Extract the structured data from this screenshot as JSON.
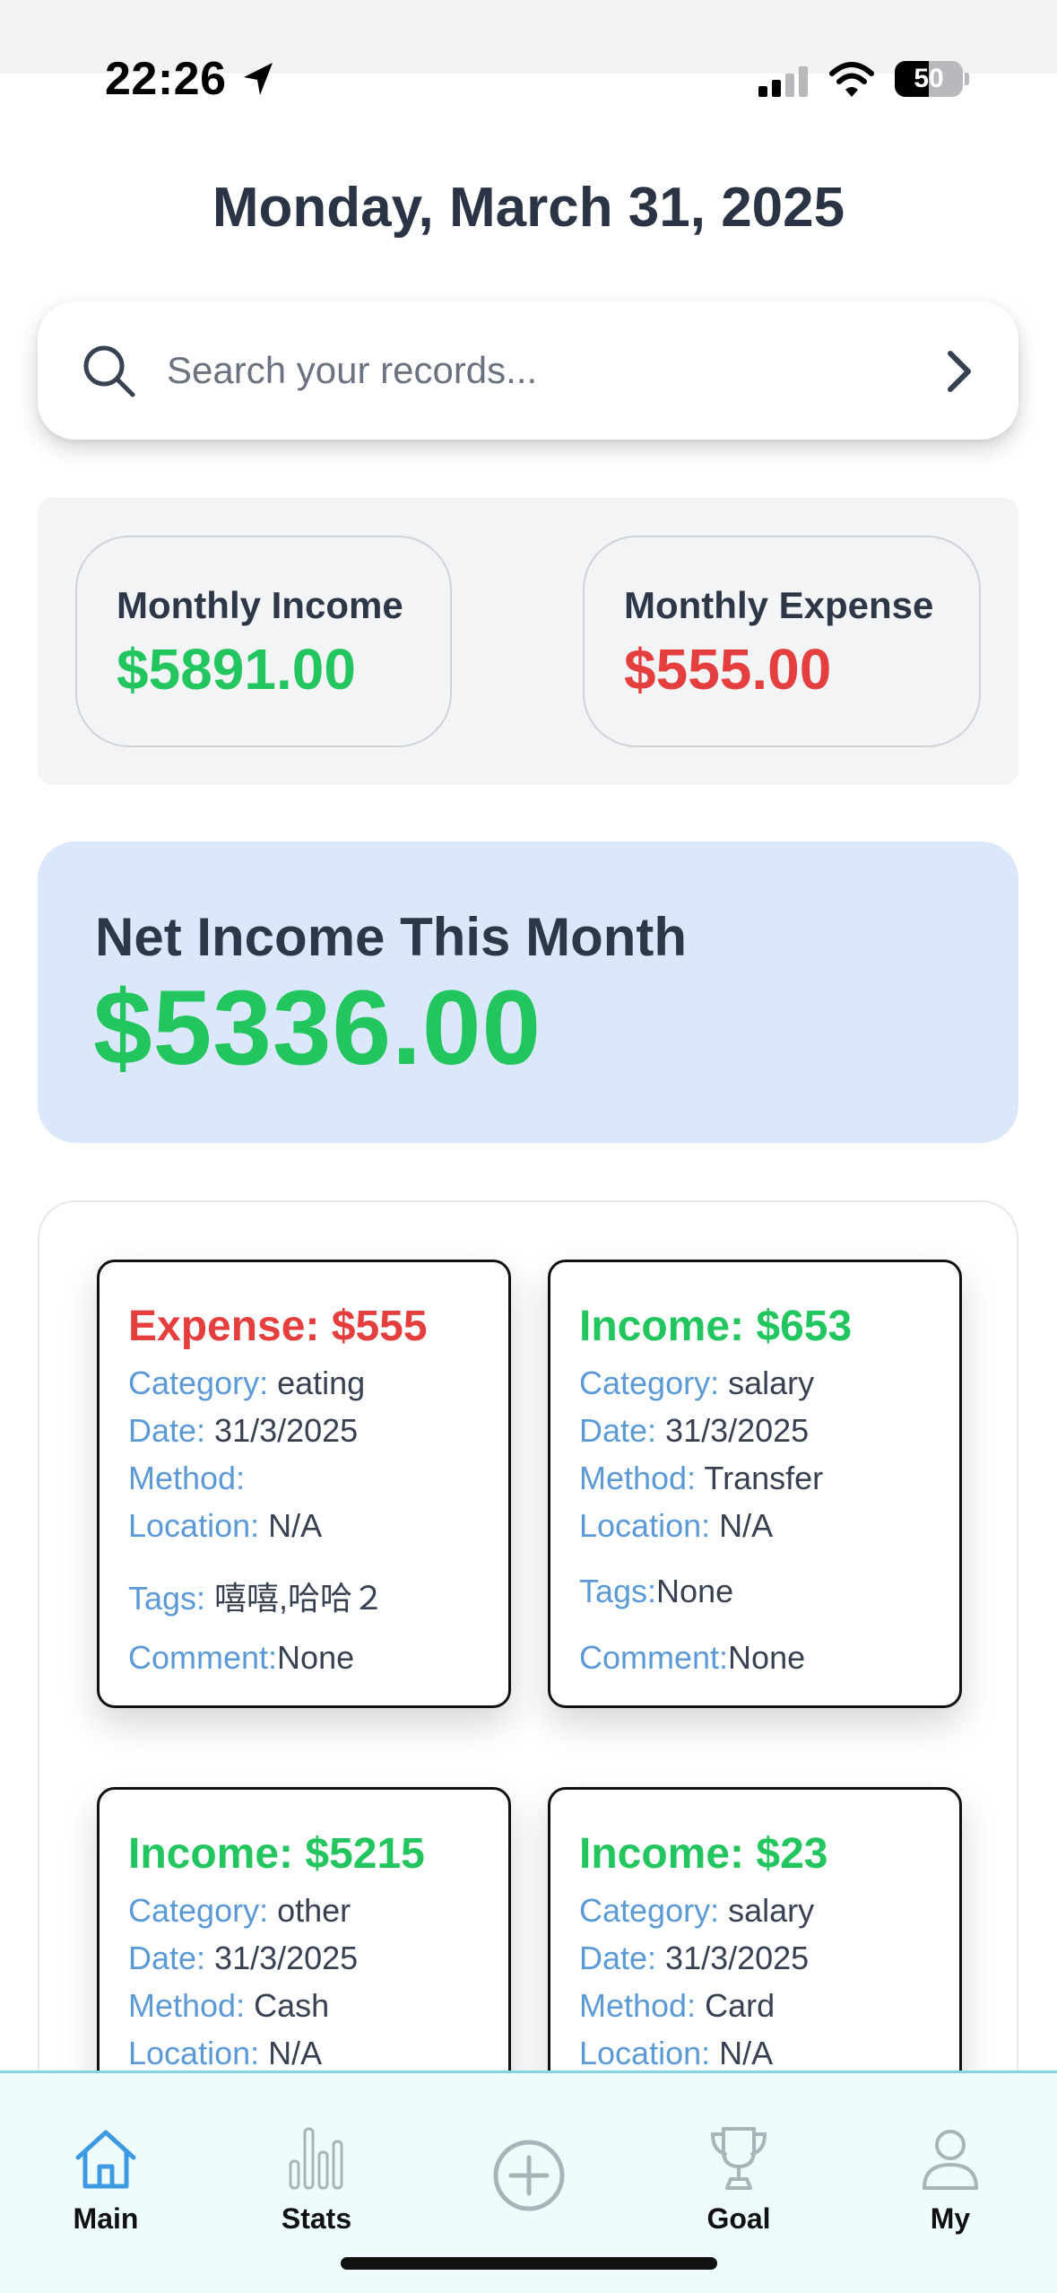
{
  "status_bar": {
    "time": "22:26",
    "battery": "50",
    "battery_level": 0.5
  },
  "header": {
    "date": "Monday, March 31, 2025"
  },
  "search": {
    "placeholder": "Search your records..."
  },
  "summary": {
    "income_label": "Monthly Income",
    "income_value": "$5891.00",
    "expense_label": "Monthly Expense",
    "expense_value": "$555.00"
  },
  "net": {
    "label": "Net Income This Month",
    "value": "$5336.00"
  },
  "records": [
    {
      "title": "Expense: $555",
      "category_key": "Category:",
      "category": " eating",
      "date_key": "Date:",
      "date": " 31/3/2025",
      "method_key": "Method:",
      "method": "",
      "location_key": "Location:",
      "location": " N/A",
      "tags_key": "Tags:",
      "tags": " 嘻嘻,哈哈２",
      "comment_key": "Comment:",
      "comment": "None"
    },
    {
      "title": "Income: $653",
      "category_key": "Category:",
      "category": " salary",
      "date_key": "Date:",
      "date": " 31/3/2025",
      "method_key": "Method:",
      "method": " Transfer",
      "location_key": "Location:",
      "location": " N/A",
      "tags_key": "Tags:",
      "tags": "None",
      "comment_key": "Comment:",
      "comment": "None"
    },
    {
      "title": "Income: $5215",
      "category_key": "Category:",
      "category": " other",
      "date_key": "Date:",
      "date": " 31/3/2025",
      "method_key": "Method:",
      "method": " Cash",
      "location_key": "Location:",
      "location": " N/A"
    },
    {
      "title": "Income: $23",
      "category_key": "Category:",
      "category": " salary",
      "date_key": "Date:",
      "date": " 31/3/2025",
      "method_key": "Method:",
      "method": " Card",
      "location_key": "Location:",
      "location": " N/A"
    }
  ],
  "nav": {
    "main": "Main",
    "stats": "Stats",
    "goal": "Goal",
    "my": "My"
  },
  "colors": {
    "income": "#22c55e",
    "expense": "#e53e3e",
    "field_key": "#5b9ad6",
    "active_tab": "#3b9ae1",
    "inactive_icon": "#a8b4b8"
  },
  "icons": {
    "location": "location-arrow-icon",
    "signal": "signal-bars-icon",
    "wifi": "wifi-icon",
    "search": "search-icon",
    "chevron": "chevron-right-icon",
    "home": "home-icon",
    "stats": "bar-chart-icon",
    "add": "plus-circle-icon",
    "goal": "trophy-icon",
    "my": "user-icon"
  }
}
